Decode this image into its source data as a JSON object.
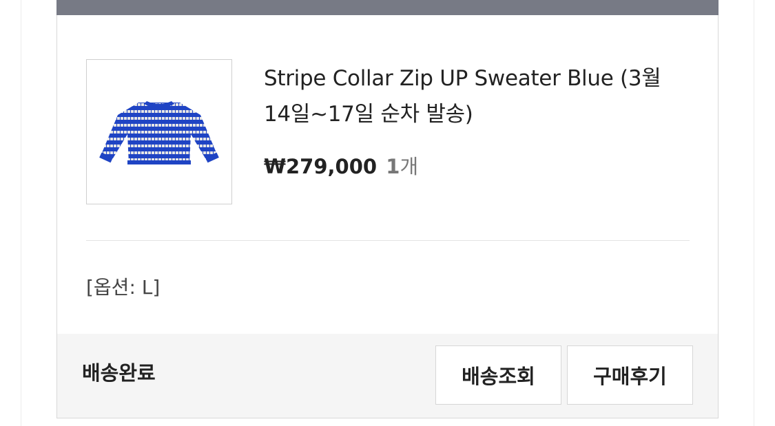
{
  "order_item": {
    "product_name": "Stripe Collar Zip UP Sweater Blue (3월 14일~17일 순차 발송)",
    "price": "₩279,000",
    "quantity": "1",
    "quantity_unit": "개",
    "option": "[옵션: L]",
    "thumbnail_icon": "blue-striped-sweater-image",
    "colors": {
      "header_bar": "#777a85",
      "footer_bg": "#f5f5f5",
      "sweater_blue": "#1f44c4",
      "sweater_stripe": "#e6e6e6"
    }
  },
  "footer": {
    "status": "배송완료",
    "tracking_button": "배송조회",
    "review_button": "구매후기"
  }
}
